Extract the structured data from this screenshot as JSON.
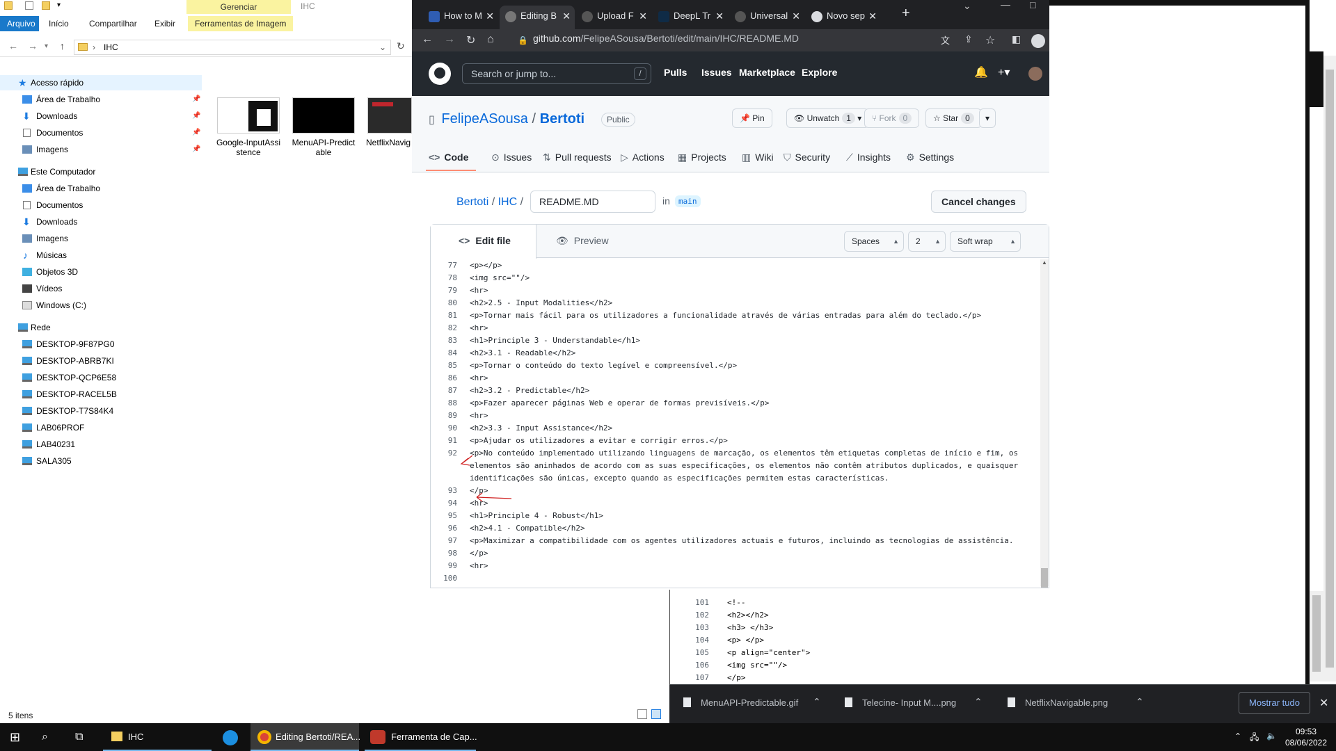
{
  "explorer": {
    "ribbon_context": "Gerenciar",
    "window_title": "IHC",
    "tabs": [
      "Arquivo",
      "Início",
      "Compartilhar",
      "Exibir",
      "Ferramentas de Imagem"
    ],
    "address": "IHC",
    "sidebar": {
      "quick_access": "Acesso rápido",
      "quick_items": [
        "Área de Trabalho",
        "Downloads",
        "Documentos",
        "Imagens"
      ],
      "this_pc": "Este Computador",
      "pc_items": [
        "Área de Trabalho",
        "Documentos",
        "Downloads",
        "Imagens",
        "Músicas",
        "Objetos 3D",
        "Vídeos",
        "Windows (C:)"
      ],
      "network": "Rede",
      "network_items": [
        "DESKTOP-9F87PG0",
        "DESKTOP-ABRB7KI",
        "DESKTOP-QCP6E58",
        "DESKTOP-RACEL5B",
        "DESKTOP-T7S84K4",
        "LAB06PROF",
        "LAB40231",
        "SALA305"
      ]
    },
    "files": [
      {
        "line1": "Google-InputAssi",
        "line2": "stence"
      },
      {
        "line1": "MenuAPI-Predict",
        "line2": "able"
      },
      {
        "line1": "NetflixNavig",
        "line2": ""
      }
    ],
    "status": "5 itens"
  },
  "chrome": {
    "tabs": [
      {
        "label": "How to M"
      },
      {
        "label": "Editing B"
      },
      {
        "label": "Upload F"
      },
      {
        "label": "DeepL Tr"
      },
      {
        "label": "Universal"
      },
      {
        "label": "Novo sep"
      }
    ],
    "url_domain": "github.com",
    "url_path": "/FelipeASousa/Bertoti/edit/main/IHC/README.MD"
  },
  "github": {
    "search_placeholder": "Search or jump to...",
    "search_key": "/",
    "nav": [
      "Pulls",
      "Issues",
      "Marketplace",
      "Explore"
    ],
    "owner": "FelipeASousa",
    "repo": "Bertoti",
    "visibility": "Public",
    "pin": "Pin",
    "unwatch": "Unwatch",
    "unwatch_count": "1",
    "fork": "Fork",
    "fork_count": "0",
    "star": "Star",
    "star_count": "0",
    "repo_tabs": [
      "Code",
      "Issues",
      "Pull requests",
      "Actions",
      "Projects",
      "Wiki",
      "Security",
      "Insights",
      "Settings"
    ],
    "breadcrumb_repo": "Bertoti",
    "breadcrumb_dir": "IHC",
    "filename": "README.MD",
    "in_label": "in",
    "branch": "main",
    "cancel": "Cancel changes",
    "edit_tab": "Edit file",
    "preview_tab": "Preview",
    "indent_mode": "Spaces",
    "indent_size": "2",
    "wrap_mode": "Soft wrap"
  },
  "code_lines": [
    {
      "n": "77",
      "t": "<p></p>"
    },
    {
      "n": "78",
      "t": "<img src=\"\"/>"
    },
    {
      "n": "79",
      "t": "<hr>"
    },
    {
      "n": "80",
      "t": "<h2>2.5 - Input Modalities</h2>"
    },
    {
      "n": "81",
      "t": "<p>Tornar mais fácil para os utilizadores a funcionalidade através de várias entradas para além do teclado.</p>"
    },
    {
      "n": "82",
      "t": "<hr>"
    },
    {
      "n": "83",
      "t": "<h1>Principle 3 - Understandable</h1>"
    },
    {
      "n": "84",
      "t": "<h2>3.1 - Readable</h2>"
    },
    {
      "n": "85",
      "t": "<p>Tornar o conteúdo do texto legível e compreensível.</p>"
    },
    {
      "n": "86",
      "t": "<hr>"
    },
    {
      "n": "87",
      "t": "<h2>3.2 - Predictable</h2>"
    },
    {
      "n": "88",
      "t": "<p>Fazer aparecer páginas Web e operar de formas previsíveis.</p>"
    },
    {
      "n": "89",
      "t": "<hr>"
    },
    {
      "n": "90",
      "t": "<h2>3.3 - Input Assistance</h2>"
    },
    {
      "n": "91",
      "t": "<p>Ajudar os utilizadores a evitar e corrigir erros.</p>"
    },
    {
      "n": "92",
      "t": "<p>No conteúdo implementado utilizando linguagens de marcação, os elementos têm etiquetas completas de início e fim, os"
    },
    {
      "n": "",
      "t": "elementos são aninhados de acordo com as suas especificações, os elementos não contêm atributos duplicados, e quaisquer"
    },
    {
      "n": "",
      "t": "identificações são únicas, excepto quando as especificações permitem estas características."
    },
    {
      "n": "93",
      "t": "</p>"
    },
    {
      "n": "94",
      "t": "<hr>"
    },
    {
      "n": "95",
      "t": "<h1>Principle 4 - Robust</h1>"
    },
    {
      "n": "96",
      "t": "<h2>4.1 - Compatible</h2>"
    },
    {
      "n": "97",
      "t": "<p>Maximizar a compatibilidade com os agentes utilizadores actuais e futuros, incluindo as tecnologias de assistência."
    },
    {
      "n": "98",
      "t": "</p>"
    },
    {
      "n": "99",
      "t": "<hr>"
    },
    {
      "n": "100",
      "t": ""
    }
  ],
  "code_lines_2": [
    {
      "n": "101",
      "t": "<!--"
    },
    {
      "n": "102",
      "t": "<h2></h2>"
    },
    {
      "n": "103",
      "t": "<h3> </h3>"
    },
    {
      "n": "104",
      "t": "<p> </p>"
    },
    {
      "n": "105",
      "t": "<p align=\"center\">"
    },
    {
      "n": "106",
      "t": "<img src=\"\"/>"
    },
    {
      "n": "107",
      "t": "</p>"
    }
  ],
  "downloads": [
    {
      "name": "MenuAPI-Predictable.gif"
    },
    {
      "name": "Telecine- Input M....png"
    },
    {
      "name": "NetflixNavigable.png"
    }
  ],
  "downloads_show_all": "Mostrar tudo",
  "taskbar": {
    "items": [
      "IHC",
      "Editing Bertoti/REA...",
      "Ferramenta de Cap..."
    ],
    "time": "09:53",
    "date": "08/06/2022"
  }
}
